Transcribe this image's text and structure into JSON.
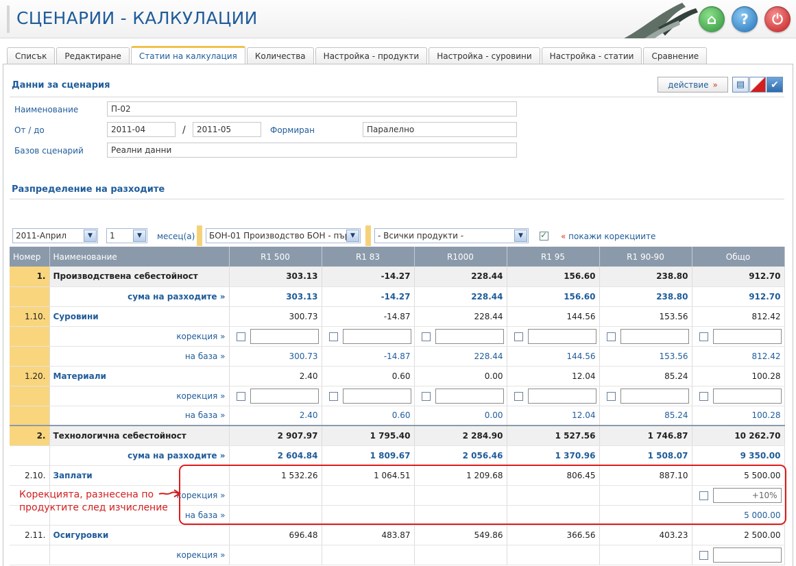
{
  "header": {
    "title": "СЦЕНАРИИ - КАЛКУЛАЦИИ"
  },
  "header_buttons": [
    {
      "name": "home-icon",
      "glyph": "⌂"
    },
    {
      "name": "help-icon",
      "glyph": "?"
    },
    {
      "name": "power-icon",
      "glyph": "⏻"
    }
  ],
  "tabs": [
    "Списък",
    "Редактиране",
    "Статии на калкулация",
    "Количества",
    "Настройка - продукти",
    "Настройка - суровини",
    "Настройка - статии",
    "Сравнение"
  ],
  "active_tab": "Статии на калкулация",
  "scenario": {
    "section_title": "Данни за сценария",
    "action_label": "действие",
    "action_arrow": "»",
    "name_label": "Наименование",
    "name_value": "П-02",
    "period_label": "От / до",
    "from_value": "2011-04",
    "separator": "/",
    "to_value": "2011-05",
    "formed_label": "Формиран",
    "formed_value": "Паралелно",
    "base_label": "Базов сценарий",
    "base_value": "Реални данни"
  },
  "distribution": {
    "section_title": "Разпределение на разходите",
    "month_select": "2011-Април",
    "count_select": "1",
    "months_label": "месец(а)",
    "unit_select": "БОН-01 Производство БОН - пър",
    "product_select": "- Всички продукти -",
    "show_corrections_arrow": "«",
    "show_corrections_label": "покажи корекциите",
    "show_corrections_checked": true
  },
  "table": {
    "headers": [
      "Номер",
      "Наименование",
      "R1 500",
      "R1 83",
      "R1000",
      "R1 95",
      "R1 90-90",
      "Общо"
    ],
    "labels": {
      "sum": "сума на разходите »",
      "correction": "корекция »",
      "base": "на база »"
    },
    "rows": [
      {
        "kind": "total",
        "num": "1.",
        "name": "Производствена себестойност",
        "values": [
          "303.13",
          "-14.27",
          "228.44",
          "156.60",
          "238.80",
          "912.70"
        ]
      },
      {
        "kind": "sum",
        "values": [
          "303.13",
          "-14.27",
          "228.44",
          "156.60",
          "238.80",
          "912.70"
        ]
      },
      {
        "kind": "item",
        "num": "1.10.",
        "name": "Суровини",
        "values": [
          "300.73",
          "-14.87",
          "228.44",
          "144.56",
          "153.56",
          "812.42"
        ]
      },
      {
        "kind": "corr",
        "inputs": [
          "",
          "",
          "",
          "",
          "",
          ""
        ]
      },
      {
        "kind": "base",
        "values": [
          "300.73",
          "-14.87",
          "228.44",
          "144.56",
          "153.56",
          "812.42"
        ]
      },
      {
        "kind": "item",
        "num": "1.20.",
        "name": "Материали",
        "values": [
          "2.40",
          "0.60",
          "0.00",
          "12.04",
          "85.24",
          "100.28"
        ]
      },
      {
        "kind": "corr",
        "inputs": [
          "",
          "",
          "",
          "",
          "",
          ""
        ]
      },
      {
        "kind": "base",
        "values": [
          "2.40",
          "0.60",
          "0.00",
          "12.04",
          "85.24",
          "100.28"
        ]
      },
      {
        "kind": "total",
        "num": "2.",
        "name": "Технологична себестойност",
        "values": [
          "2 907.97",
          "1 795.40",
          "2 284.90",
          "1 527.56",
          "1 746.87",
          "10 262.70"
        ]
      },
      {
        "kind": "sum",
        "values": [
          "2 604.84",
          "1 809.67",
          "2 056.46",
          "1 370.96",
          "1 508.07",
          "9 350.00"
        ]
      },
      {
        "kind": "itemw",
        "num": "2.10.",
        "name": "Заплати",
        "values": [
          "1 532.26",
          "1 064.51",
          "1 209.68",
          "806.45",
          "887.10",
          "5 500.00"
        ]
      },
      {
        "kind": "corrlast",
        "last_input": "+10%"
      },
      {
        "kind": "baselast",
        "last_value": "5 000.00"
      },
      {
        "kind": "itemw",
        "num": "2.11.",
        "name": "Осигуровки",
        "values": [
          "696.48",
          "483.87",
          "549.86",
          "366.56",
          "403.23",
          "2 500.00"
        ]
      },
      {
        "kind": "corrlast",
        "last_input": ""
      }
    ]
  },
  "annotation": {
    "text_line1": "Корекцията, разнесена по",
    "text_line2": "продуктите след изчисление",
    "color": "#e01a1a"
  }
}
